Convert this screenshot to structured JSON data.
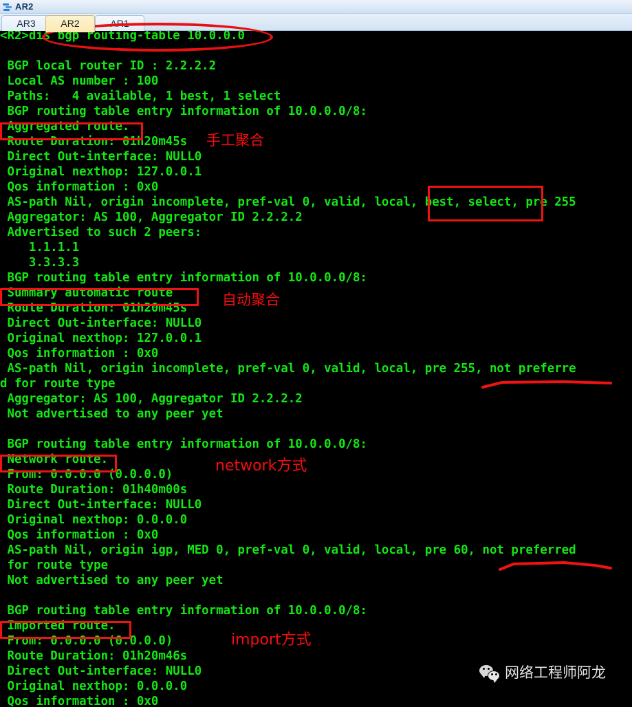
{
  "window": {
    "title": "AR2",
    "icon": "router-icon"
  },
  "tabs": [
    {
      "label": "AR3",
      "active": false
    },
    {
      "label": "AR2",
      "active": true
    },
    {
      "label": "AR1",
      "active": false
    }
  ],
  "terminal": {
    "foreground": "#14e614",
    "background": "#000000",
    "lines": [
      "<R2>dis bgp routing-table 10.0.0.0",
      "",
      " BGP local router ID : 2.2.2.2",
      " Local AS number : 100",
      " Paths:   4 available, 1 best, 1 select",
      " BGP routing table entry information of 10.0.0.0/8:",
      " Aggregated route.",
      " Route Duration: 01h20m45s",
      " Direct Out-interface: NULL0",
      " Original nexthop: 127.0.0.1",
      " Qos information : 0x0",
      " AS-path Nil, origin incomplete, pref-val 0, valid, local, best, select, pre 255",
      " Aggregator: AS 100, Aggregator ID 2.2.2.2",
      " Advertised to such 2 peers:",
      "    1.1.1.1",
      "    3.3.3.3",
      " BGP routing table entry information of 10.0.0.0/8:",
      " Summary automatic route",
      " Route Duration: 01h20m45s",
      " Direct Out-interface: NULL0",
      " Original nexthop: 127.0.0.1",
      " Qos information : 0x0",
      " AS-path Nil, origin incomplete, pref-val 0, valid, local, pre 255, not preferre",
      "d for route type",
      " Aggregator: AS 100, Aggregator ID 2.2.2.2",
      " Not advertised to any peer yet",
      "",
      " BGP routing table entry information of 10.0.0.0/8:",
      " Network route.",
      " From: 0.0.0.0 (0.0.0.0)",
      " Route Duration: 01h40m00s",
      " Direct Out-interface: NULL0",
      " Original nexthop: 0.0.0.0",
      " Qos information : 0x0",
      " AS-path Nil, origin igp, MED 0, pref-val 0, valid, local, pre 60, not preferred",
      " for route type",
      " Not advertised to any peer yet",
      "",
      " BGP routing table entry information of 10.0.0.0/8:",
      " Imported route.",
      " From: 0.0.0.0 (0.0.0.0)",
      " Route Duration: 01h20m46s",
      " Direct Out-interface: NULL0",
      " Original nexthop: 0.0.0.0",
      " Qos information : 0x0"
    ]
  },
  "annotations": {
    "color": "#ef1313",
    "items": [
      {
        "name": "command-ellipse",
        "kind": "ellipse",
        "label": ""
      },
      {
        "name": "aggregated-route-box",
        "kind": "box",
        "label": ""
      },
      {
        "name": "manual-aggregation-label",
        "kind": "text",
        "label": "手工聚合"
      },
      {
        "name": "best-select-box",
        "kind": "box",
        "label": ""
      },
      {
        "name": "summary-automatic-route-box",
        "kind": "box",
        "label": ""
      },
      {
        "name": "auto-aggregation-label",
        "kind": "text",
        "label": "自动聚合"
      },
      {
        "name": "not-preferred-underline-1",
        "kind": "underline",
        "label": ""
      },
      {
        "name": "network-route-box",
        "kind": "box",
        "label": ""
      },
      {
        "name": "network-mode-label",
        "kind": "text",
        "label": "network方式"
      },
      {
        "name": "not-preferred-underline-2",
        "kind": "underline",
        "label": ""
      },
      {
        "name": "imported-route-box",
        "kind": "box",
        "label": ""
      },
      {
        "name": "import-mode-label",
        "kind": "text",
        "label": "import方式"
      }
    ]
  },
  "watermark": {
    "icon": "wechat-icon",
    "text": "网络工程师阿龙"
  }
}
